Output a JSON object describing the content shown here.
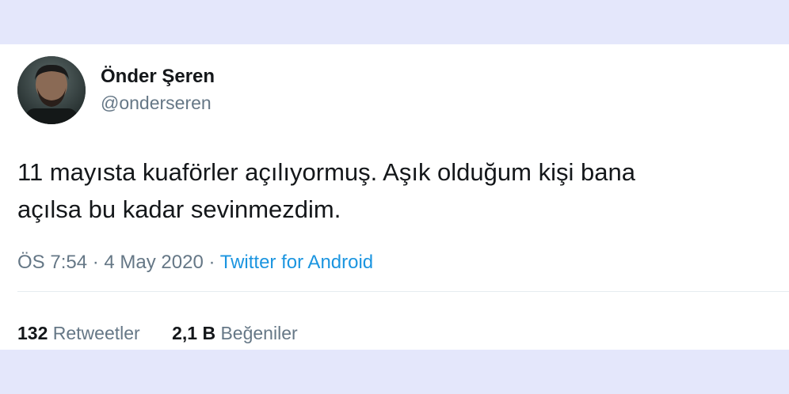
{
  "author": {
    "name": "Önder Şeren",
    "handle": "@onderseren",
    "avatar_label": "profile photo"
  },
  "tweet": {
    "line1": "11 mayısta kuaförler açılıyormuş. Aşık olduğum kişi bana",
    "line2": "açılsa bu kadar sevinmezdim."
  },
  "meta": {
    "time": "ÖS 7:54",
    "separator": "·",
    "date": "4 May 2020",
    "source": "Twitter for Android"
  },
  "stats": {
    "retweets": {
      "count": "132",
      "label": "Retweetler"
    },
    "likes": {
      "count": "2,1 B",
      "label": "Beğeniler"
    }
  },
  "colors": {
    "page_background": "#e4e7fb",
    "card_background": "#ffffff",
    "accent_link": "#1b95e0",
    "muted_text": "#657786"
  }
}
